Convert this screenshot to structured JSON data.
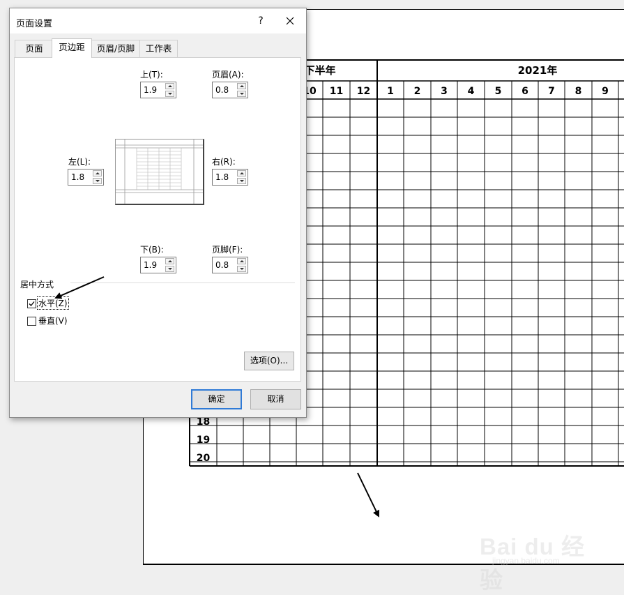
{
  "dialog": {
    "title": "页面设置",
    "help_label": "?",
    "tabs": [
      {
        "label": "页面",
        "active": false
      },
      {
        "label": "页边距",
        "active": true
      },
      {
        "label": "页眉/页脚",
        "active": false
      },
      {
        "label": "工作表",
        "active": false
      }
    ],
    "margins": {
      "top": {
        "label": "上(T):",
        "value": "1.9"
      },
      "header": {
        "label": "页眉(A):",
        "value": "0.8"
      },
      "left": {
        "label": "左(L):",
        "value": "1.8"
      },
      "right": {
        "label": "右(R):",
        "value": "1.8"
      },
      "bottom": {
        "label": "下(B):",
        "value": "1.9"
      },
      "footer": {
        "label": "页脚(F):",
        "value": "0.8"
      }
    },
    "centering": {
      "section_label": "居中方式",
      "horizontal": {
        "label": "水平(Z)",
        "checked": true
      },
      "vertical": {
        "label": "垂直(V)",
        "checked": false
      }
    },
    "options_button": "选项(O)...",
    "ok_button": "确定",
    "cancel_button": "取消"
  },
  "sheet": {
    "header_left": "下半年",
    "header_right": "2021年",
    "month_columns": [
      "10",
      "11",
      "12",
      "1",
      "2",
      "3",
      "4",
      "5",
      "6",
      "7",
      "8",
      "9"
    ],
    "row_numbers": [
      "18",
      "19",
      "20"
    ]
  },
  "watermark": {
    "text": "Bai du 经验",
    "url": "jingyan.baidu.com"
  },
  "colors": {
    "ok_border": "#2f7ad6",
    "dialog_bg": "#f0f0f0"
  }
}
